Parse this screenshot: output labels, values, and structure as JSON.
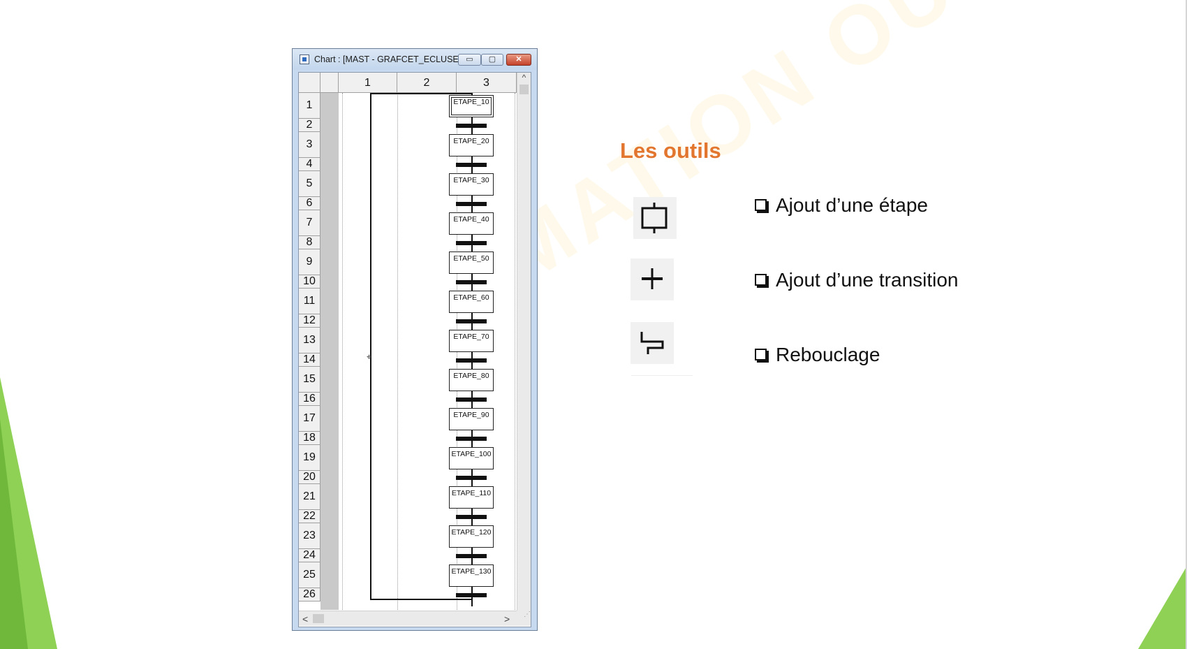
{
  "window": {
    "title": "Chart : [MAST - GRAFCET_ECLUSE]",
    "buttons": {
      "minimize": "▭",
      "maximize": "▢",
      "close": "✕"
    }
  },
  "grid": {
    "columns": [
      "1",
      "2",
      "3"
    ],
    "rows": [
      "1",
      "2",
      "3",
      "4",
      "5",
      "6",
      "7",
      "8",
      "9",
      "10",
      "11",
      "12",
      "13",
      "14",
      "15",
      "16",
      "17",
      "18",
      "19",
      "20",
      "21",
      "22",
      "23",
      "24",
      "25",
      "26"
    ]
  },
  "steps": [
    "ETAPE_10",
    "ETAPE_20",
    "ETAPE_30",
    "ETAPE_40",
    "ETAPE_50",
    "ETAPE_60",
    "ETAPE_70",
    "ETAPE_80",
    "ETAPE_90",
    "ETAPE_100",
    "ETAPE_110",
    "ETAPE_120",
    "ETAPE_130"
  ],
  "scroll": {
    "up": "^",
    "left": "<",
    "right": ">"
  },
  "panel": {
    "heading": "Les outils",
    "items": [
      {
        "label": "Ajout d’une étape",
        "icon": "step-tool-icon"
      },
      {
        "label": "Ajout d’une transition",
        "icon": "transition-tool-icon"
      },
      {
        "label": "Rebouclage",
        "icon": "loopback-tool-icon"
      }
    ]
  },
  "watermark": "AUTOMATION OUEST",
  "colors": {
    "heading": "#e2762f",
    "accent_green": "#8ed155",
    "window_frame": "#c6d9ee"
  }
}
